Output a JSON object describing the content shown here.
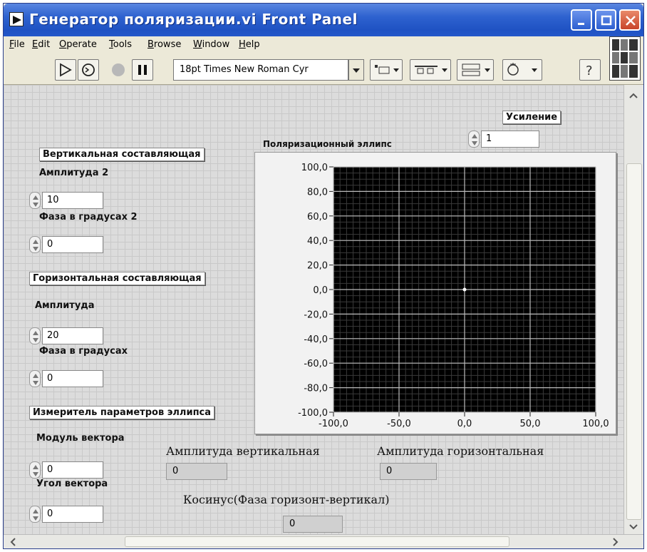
{
  "window": {
    "title": "Генератор поляризации.vi Front Panel"
  },
  "menu": [
    "File",
    "Edit",
    "Operate",
    "Tools",
    "Browse",
    "Window",
    "Help"
  ],
  "toolbar": {
    "font": "18pt Times New Roman Cyr"
  },
  "controls": {
    "gain_label": "Усиление",
    "gain_value": "1",
    "vertical_section": "Вертикальная составляющая",
    "amp2_label": "Амплитуда 2",
    "amp2_value": "10",
    "phase2_label": "Фаза в градусах 2",
    "phase2_value": "0",
    "horizontal_section": "Горизонтальная составляющая",
    "amp_label": "Амплитуда",
    "amp_value": "20",
    "phase_label": "Фаза в градусах",
    "phase_value": "0",
    "meter_section": "Измеритель параметров эллипса",
    "modulus_label": "Модуль вектора",
    "modulus_value": "0",
    "angle_label": "Угол вектора",
    "angle_value": "0"
  },
  "indicators": {
    "amp_vert_label": "Амплитуда вертикальная",
    "amp_vert_value": "0",
    "amp_horiz_label": "Амплитуда горизонтальная",
    "amp_horiz_value": "0",
    "cos_label": "Косинус(Фаза горизонт-вертикал)",
    "cos_value": "0"
  },
  "chart_data": {
    "type": "scatter",
    "title": "Поляризационный эллипс",
    "xlabel": "",
    "ylabel": "",
    "xlim": [
      -100,
      100
    ],
    "ylim": [
      -100,
      100
    ],
    "x_ticks": [
      "-100,0",
      "-50,0",
      "0,0",
      "50,0",
      "100,0"
    ],
    "y_ticks": [
      "100,0",
      "80,0",
      "60,0",
      "40,0",
      "20,0",
      "0,0",
      "-20,0",
      "-40,0",
      "-60,0",
      "-80,0",
      "-100,0"
    ],
    "grid": true,
    "plot_background": "#000000",
    "grid_color": "#bbbbbb",
    "points": [
      {
        "x": 0,
        "y": 0
      }
    ]
  }
}
